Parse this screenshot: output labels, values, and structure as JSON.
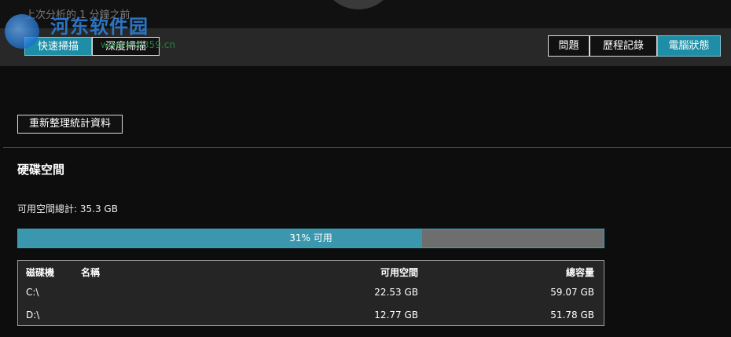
{
  "header": {
    "last_scan": "上次分析的 1 分鐘之前"
  },
  "watermark": {
    "title": "河东软件园",
    "url": "www.pc0359.cn"
  },
  "toolbar": {
    "quick_scan": "快速掃描",
    "deep_scan": "深度掃描",
    "issues": "問題",
    "history": "歷程記錄",
    "pc_status": "電腦狀態"
  },
  "actions": {
    "refresh": "重新整理統計資料"
  },
  "disk": {
    "section_title": "硬碟空間",
    "free_total": "可用空間總計: 35.3 GB",
    "usage_percent": 0.69,
    "usage_label": "31% 可用",
    "columns": {
      "drive": "磁碟機",
      "name": "名稱",
      "free": "可用空間",
      "total": "總容量"
    },
    "rows": [
      {
        "drive": "C:\\",
        "name": "",
        "free": "22.53 GB",
        "total": "59.07 GB"
      },
      {
        "drive": "D:\\",
        "name": "",
        "free": "12.77 GB",
        "total": "51.78 GB"
      }
    ]
  },
  "colors": {
    "accent": "#1e8ea6",
    "bar_fill": "#3a97ae",
    "bar_empty": "#6e6e6e"
  }
}
